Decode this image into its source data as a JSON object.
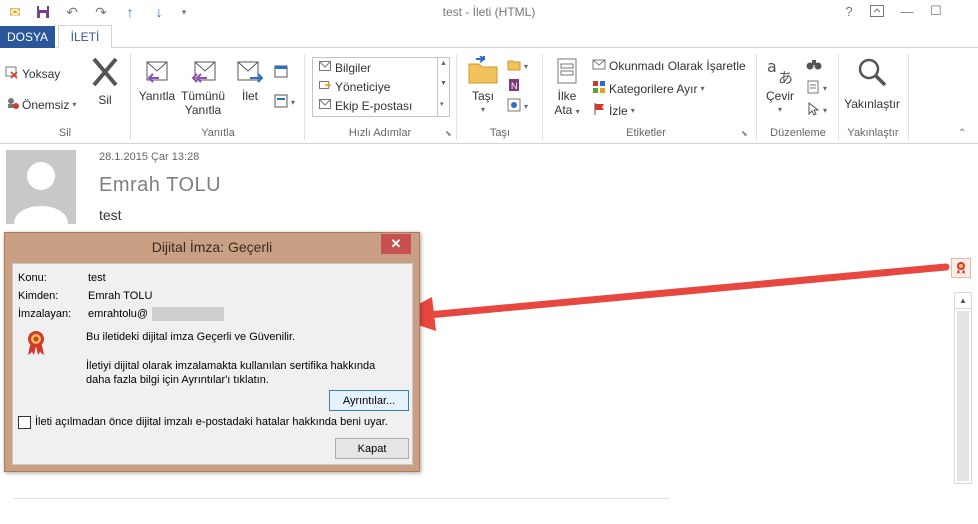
{
  "window": {
    "title": "test - İleti (HTML)",
    "help": "?",
    "ribbon_display": "⬚",
    "minimize": "—",
    "maximize": "☐"
  },
  "tabs": {
    "file": "DOSYA",
    "message": "İLETİ"
  },
  "ribbon": {
    "delete_group": {
      "label": "Sil",
      "ignore": "Yoksay",
      "junk": "Önemsiz",
      "delete": "Sil"
    },
    "respond_group": {
      "label": "Yanıtla",
      "reply": "Yanıtla",
      "reply_all_line1": "Tümünü",
      "reply_all_line2": "Yanıtla",
      "forward": "İlet"
    },
    "quick_steps_group": {
      "label": "Hızlı Adımlar",
      "items": [
        "Bilgiler",
        "Yöneticiye",
        "Ekip E-postası"
      ]
    },
    "move_group": {
      "label": "Taşı",
      "move": "Taşı"
    },
    "tags_group": {
      "label": "Etiketler",
      "policy_line1": "İlke",
      "policy_line2": "Ata",
      "mark_unread": "Okunmadı Olarak İşaretle",
      "categorize": "Kategorilere Ayır",
      "follow_up": "İzle"
    },
    "editing_group": {
      "label": "Düzenleme",
      "translate": "Çevir"
    },
    "zoom_group": {
      "label": "Yakınlaştır",
      "zoom": "Yakınlaştır"
    }
  },
  "message": {
    "date": "28.1.2015 Çar 13:28",
    "sender": "Emrah  TOLU",
    "subject": "test"
  },
  "dialog": {
    "title": "Dijital İmza: Geçerli",
    "close": "✕",
    "subject_label": "Konu:",
    "subject_value": "test",
    "from_label": "Kimden:",
    "from_value": "Emrah  TOLU",
    "signer_label": "İmzalayan:",
    "signer_value": "emrahtolu@",
    "status_text": "Bu iletideki dijital imza Geçerli ve Güvenilir.",
    "info_line1": "İletiyi dijital olarak imzalamakta kullanılan sertifika hakkında",
    "info_line2": "daha fazla bilgi için Ayrıntılar'ı tıklatın.",
    "details_button": "Ayrıntılar...",
    "warn_checkbox": "İleti açılmadan önce dijital imzalı e-postadaki hatalar hakkında beni uyar.",
    "close_button": "Kapat"
  },
  "colors": {
    "accent": "#2b579a",
    "dialog_frame": "#c9a083",
    "close_red": "#c75050",
    "arrow_red": "#e8473f"
  }
}
